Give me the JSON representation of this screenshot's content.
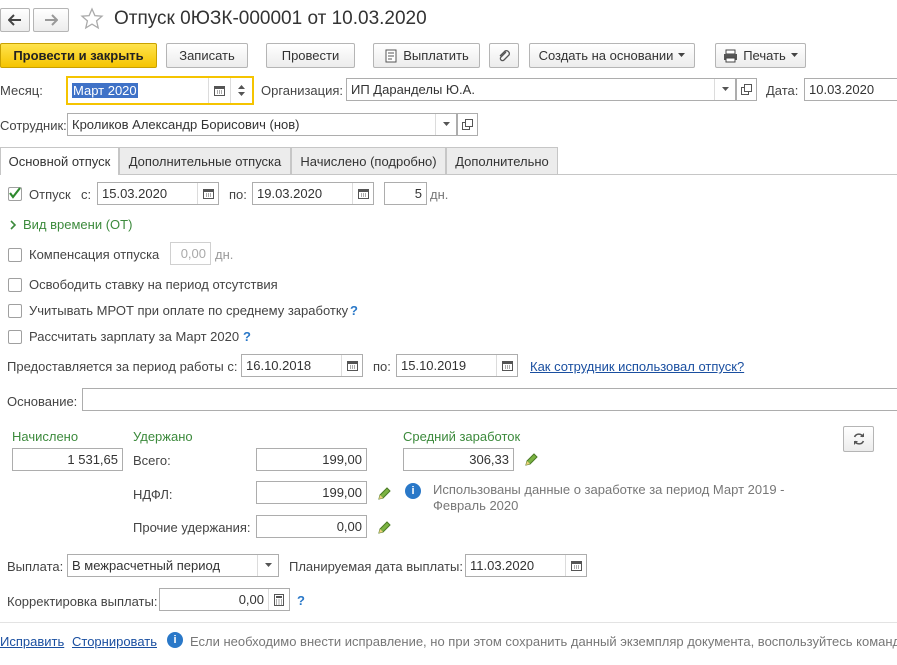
{
  "title": "Отпуск 0ЮЗК-000001 от 10.03.2020",
  "toolbar": {
    "post_close": "Провести и закрыть",
    "save": "Записать",
    "post": "Провести",
    "pay": "Выплатить",
    "create_based": "Создать на основании",
    "print": "Печать"
  },
  "header": {
    "month_label": "Месяц:",
    "month_value": "Март 2020",
    "org_label": "Организация:",
    "org_value": "ИП Даранделы Ю.А.",
    "date_label": "Дата:",
    "date_value": "10.03.2020",
    "employee_label": "Сотрудник:",
    "employee_value": "Кроликов Александр Борисович (нов)"
  },
  "tabs": [
    {
      "label": "Основной отпуск"
    },
    {
      "label": "Дополнительные отпуска"
    },
    {
      "label": "Начислено (подробно)"
    },
    {
      "label": "Дополнительно"
    }
  ],
  "vacation": {
    "label": "Отпуск",
    "from_label": "с:",
    "from_value": "15.03.2020",
    "to_label": "по:",
    "to_value": "19.03.2020",
    "days_value": "5",
    "days_unit": "дн.",
    "time_type": "Вид времени (ОТ)"
  },
  "options": {
    "compensation_label": "Компенсация отпуска",
    "compensation_value": "0,00",
    "compensation_unit": "дн.",
    "free_rate": "Освободить ставку на период отсутствия",
    "mrot": "Учитывать МРОТ при оплате по среднему заработку",
    "calc_salary": "Рассчитать зарплату за Март 2020",
    "help": "?"
  },
  "period": {
    "label": "Предоставляется за период работы с:",
    "from_value": "16.10.2018",
    "to_label": "по:",
    "to_value": "15.10.2019",
    "link": "Как сотрудник использовал отпуск?"
  },
  "basis": {
    "label": "Основание:",
    "value": ""
  },
  "totals": {
    "accrued_label": "Начислено",
    "accrued_value": "1 531,65",
    "withheld_label": "Удержано",
    "total_label": "Всего:",
    "total_value": "199,00",
    "ndfl_label": "НДФЛ:",
    "ndfl_value": "199,00",
    "other_label": "Прочие удержания:",
    "other_value": "0,00",
    "avg_label": "Средний заработок",
    "avg_value": "306,33",
    "avg_info": "Использованы данные о заработке за период Март 2019 - Февраль 2020"
  },
  "payment": {
    "label": "Выплата:",
    "value": "В межрасчетный период",
    "planned_label": "Планируемая дата выплаты:",
    "planned_value": "11.03.2020",
    "correction_label": "Корректировка выплаты:",
    "correction_value": "0,00"
  },
  "footer": {
    "fix": "Исправить",
    "reverse": "Сторнировать",
    "info": "Если необходимо внести исправление, но при этом сохранить данный экземпляр документа, воспользуйтесь команд"
  },
  "colors": {
    "accent_yellow": "#f5c400",
    "label_green": "#3c8a3c",
    "link_blue": "#1a4fa0",
    "info_blue": "#2a78c8"
  }
}
